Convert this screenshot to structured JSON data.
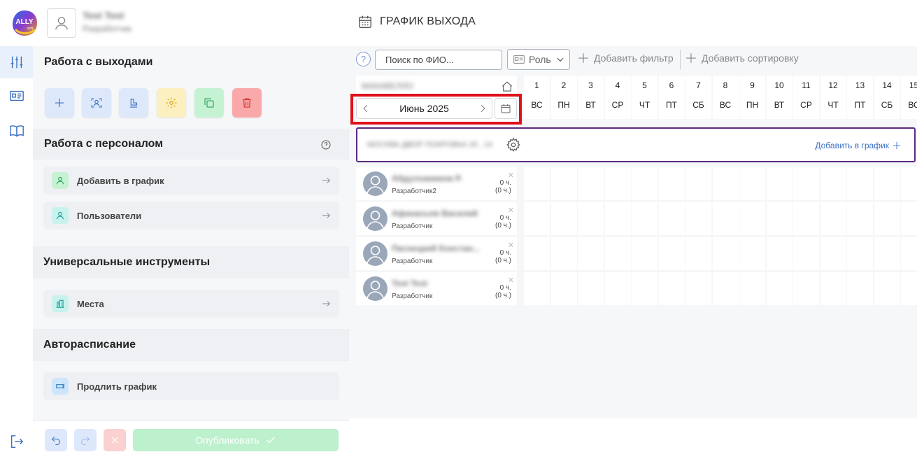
{
  "header": {
    "logo_text": "ALLY",
    "logo_sub": "soft",
    "user_name": "Test Test",
    "user_role": "Разработчик",
    "page_title": "ГРАФИК ВЫХОДА"
  },
  "left_panel": {
    "sections": {
      "shifts": "Работа с выходами",
      "staff": "Работа с персоналом",
      "tools": "Универсальные инструменты",
      "auto": "Авторасписание"
    },
    "staff_items": [
      {
        "label": "Добавить в график"
      },
      {
        "label": "Пользователи"
      }
    ],
    "tools_items": [
      {
        "label": "Места"
      }
    ],
    "auto_items": [
      {
        "label": "Продлить график"
      }
    ],
    "publish_label": "Опубликовать"
  },
  "toolbar": {
    "help": "?",
    "search_placeholder": "Поиск по ФИО...",
    "role_label": "Роль",
    "add_filter": "Добавить фильтр",
    "add_sort": "Добавить сортировку"
  },
  "calendar": {
    "org_name": "МАКАВЕЛЛО",
    "month_label": "Июнь 2025",
    "days": [
      {
        "num": "1",
        "dow": "ВС"
      },
      {
        "num": "2",
        "dow": "ПН"
      },
      {
        "num": "3",
        "dow": "ВТ"
      },
      {
        "num": "4",
        "dow": "СР"
      },
      {
        "num": "5",
        "dow": "ЧТ"
      },
      {
        "num": "6",
        "dow": "ПТ"
      },
      {
        "num": "7",
        "dow": "СБ"
      },
      {
        "num": "8",
        "dow": "ВС"
      },
      {
        "num": "9",
        "dow": "ПН"
      },
      {
        "num": "10",
        "dow": "ВТ"
      },
      {
        "num": "11",
        "dow": "СР"
      },
      {
        "num": "12",
        "dow": "ЧТ"
      },
      {
        "num": "13",
        "dow": "ПТ"
      },
      {
        "num": "14",
        "dow": "СБ"
      },
      {
        "num": "15",
        "dow": "ВС"
      }
    ]
  },
  "group": {
    "name": "МОСКВА ДВОР ПОКРОВКА 26 , 14",
    "add_label": "Добавить в график"
  },
  "employees": [
    {
      "name": "Абдулхакимов Р.",
      "role": "Разработчик2",
      "hours": "0 ч.",
      "hours2": "(0 ч.)"
    },
    {
      "name": "Афанасьев Василий",
      "role": "Разработчик",
      "hours": "0 ч.",
      "hours2": "(0 ч.)"
    },
    {
      "name": "Паснецкий Констан...",
      "role": "Разработчик",
      "hours": "0 ч.",
      "hours2": "(0 ч.)"
    },
    {
      "name": "Test Test",
      "role": "Разработчик",
      "hours": "0 ч.",
      "hours2": "(0 ч.)"
    }
  ],
  "colors": {
    "accent": "#3a6fc4",
    "group_border": "#5b2a7e",
    "highlight": "#e0101a",
    "publish_bg": "#bdf0cd"
  }
}
